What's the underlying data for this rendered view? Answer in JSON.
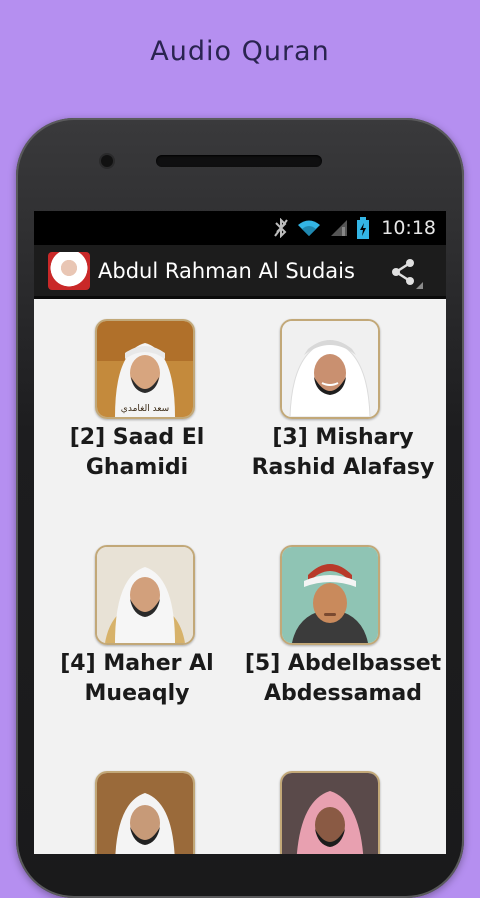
{
  "promo": {
    "title": "Audio Quran"
  },
  "status_bar": {
    "time": "10:18"
  },
  "action_bar": {
    "title": "Abdul Rahman Al Sudais",
    "app_icon": "reciter-avatar",
    "share_icon": "share-icon"
  },
  "reciters": [
    {
      "label_line1": "[2] Saad El",
      "label_line2": "Ghamidi"
    },
    {
      "label_line1": "[3] Mishary",
      "label_line2": "Rashid Alafasy"
    },
    {
      "label_line1": "[4] Maher Al",
      "label_line2": "Mueaqly"
    },
    {
      "label_line1": "[5] Abdelbasset",
      "label_line2": "Abdessamad"
    }
  ],
  "colors": {
    "background": "#b58ff0",
    "action_bar": "#1c1c1c",
    "list_background": "#f2f2f2"
  }
}
